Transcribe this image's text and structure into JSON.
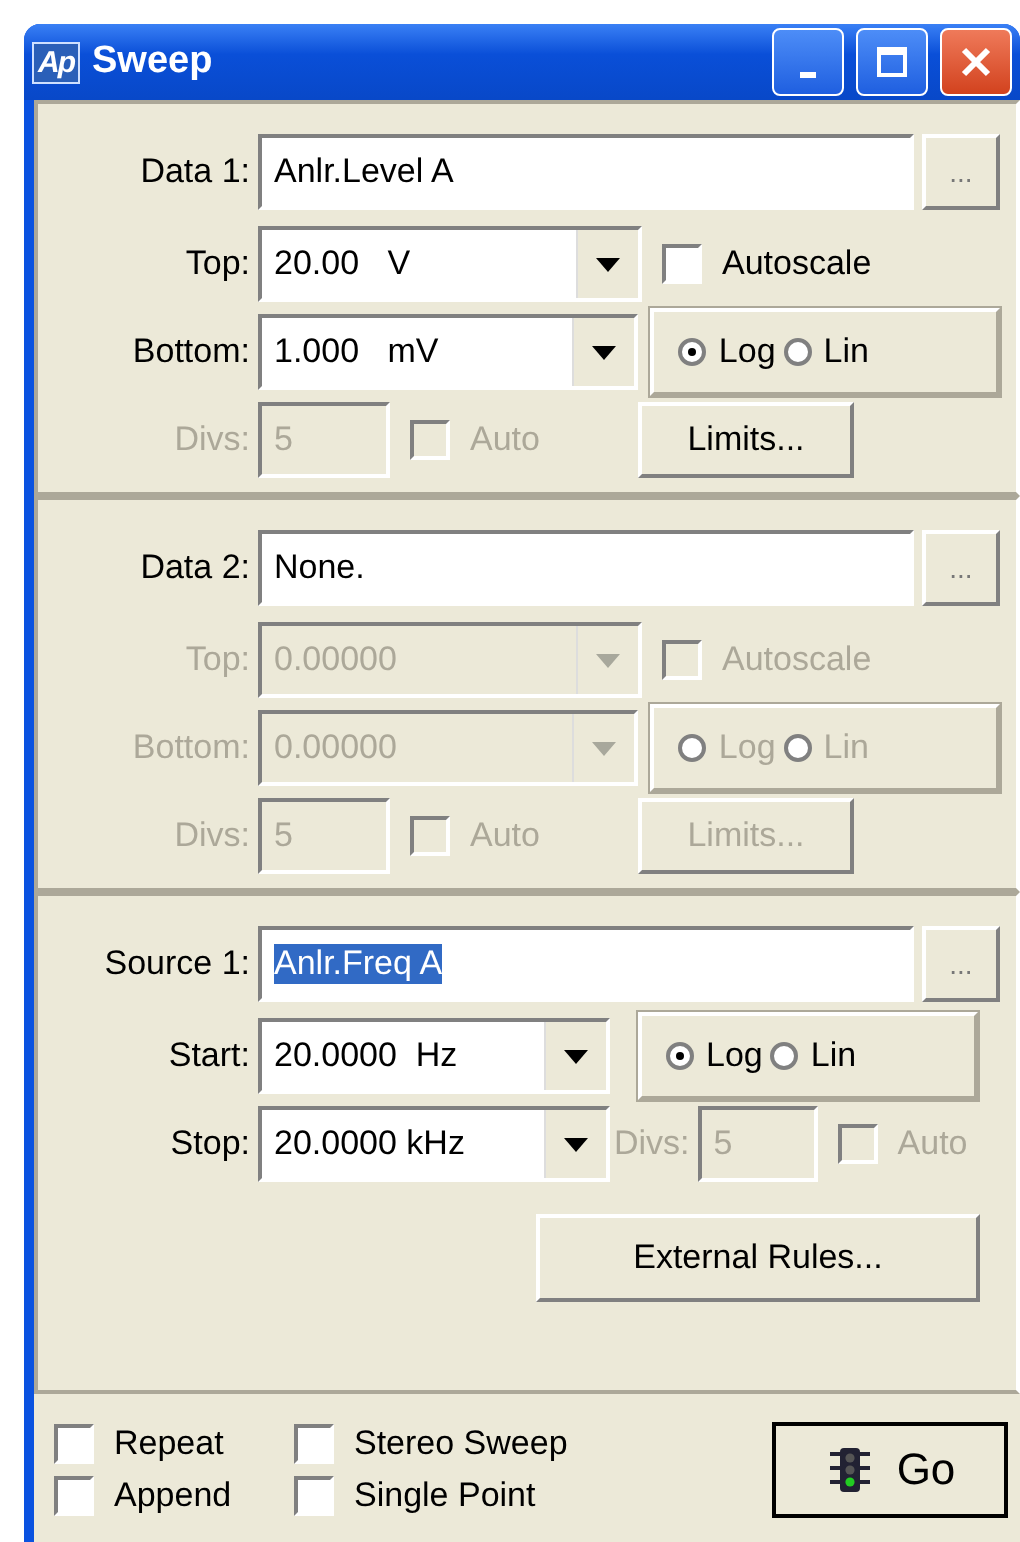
{
  "window": {
    "title": "Sweep",
    "logo": "Ap"
  },
  "data_sections": [
    {
      "label": "Data 1:",
      "value": "Anlr.Level A",
      "browse": "...",
      "top": {
        "label": "Top:",
        "value": "20.00   V",
        "disabled": false
      },
      "bottom": {
        "label": "Bottom:",
        "value": "1.000   mV",
        "disabled": false
      },
      "autoscale": {
        "label": "Autoscale",
        "checked": false,
        "disabled": false
      },
      "scale": [
        {
          "label": "Log",
          "selected": true
        },
        {
          "label": "Lin",
          "selected": false
        }
      ],
      "scale_disabled": false,
      "divs": {
        "label": "Divs:",
        "value": "5",
        "disabled": true
      },
      "auto": {
        "label": "Auto",
        "checked": false,
        "disabled": true
      },
      "limits": {
        "label": "Limits...",
        "disabled": false
      }
    },
    {
      "label": "Data 2:",
      "value": "None.",
      "browse": "...",
      "top": {
        "label": "Top:",
        "value": "0.00000",
        "disabled": true
      },
      "bottom": {
        "label": "Bottom:",
        "value": "0.00000",
        "disabled": true
      },
      "autoscale": {
        "label": "Autoscale",
        "checked": false,
        "disabled": true
      },
      "scale": [
        {
          "label": "Log",
          "selected": false
        },
        {
          "label": "Lin",
          "selected": false
        }
      ],
      "scale_disabled": true,
      "divs": {
        "label": "Divs:",
        "value": "5",
        "disabled": true
      },
      "auto": {
        "label": "Auto",
        "checked": false,
        "disabled": true
      },
      "limits": {
        "label": "Limits...",
        "disabled": true
      }
    }
  ],
  "source": {
    "label": "Source 1:",
    "value": "Anlr.Freq A",
    "text_selected": true,
    "browse": "...",
    "start": {
      "label": "Start:",
      "value": "20.0000  Hz"
    },
    "stop": {
      "label": "Stop:",
      "value": "20.0000 kHz"
    },
    "scale": [
      {
        "label": "Log",
        "selected": true
      },
      {
        "label": "Lin",
        "selected": false
      }
    ],
    "divs": {
      "label": "Divs:",
      "value": "5",
      "disabled": true
    },
    "auto": {
      "label": "Auto",
      "checked": false,
      "disabled": true
    },
    "external_rules": "External Rules..."
  },
  "options": [
    {
      "label": "Repeat",
      "checked": false
    },
    {
      "label": "Stereo Sweep",
      "checked": false
    },
    {
      "label": "Append",
      "checked": false
    },
    {
      "label": "Single Point",
      "checked": false
    }
  ],
  "go_button": "Go"
}
